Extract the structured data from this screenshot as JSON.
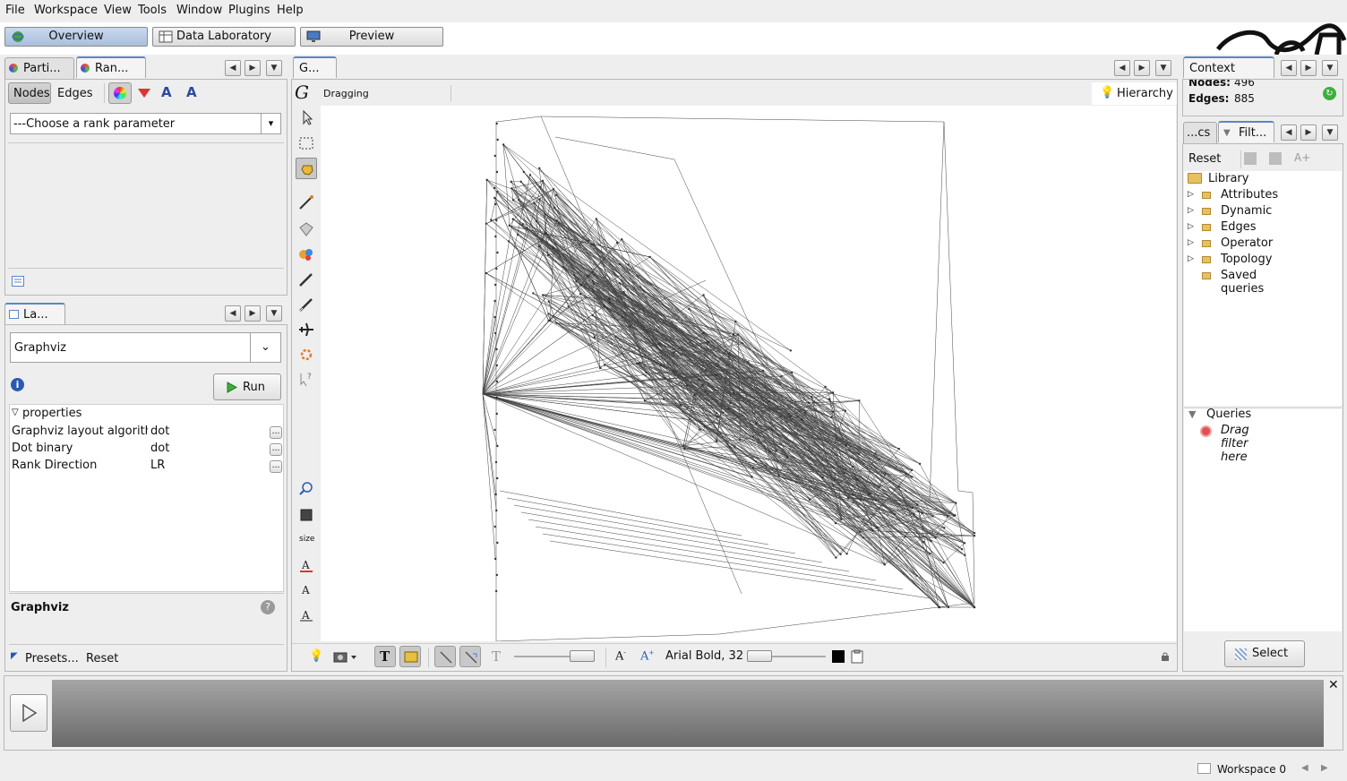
{
  "menu": [
    "File",
    "Workspace",
    "View",
    "Tools",
    "Window",
    "Plugins",
    "Help"
  ],
  "perspectives": [
    {
      "label": "Overview",
      "selected": true
    },
    {
      "label": "Data Laboratory",
      "selected": false
    },
    {
      "label": "Preview",
      "selected": false
    }
  ],
  "left_top": {
    "tabs": [
      "Parti...",
      "Ran..."
    ],
    "subtabs": [
      "Nodes",
      "Edges"
    ],
    "rank_select": "---Choose a rank parameter"
  },
  "layout_panel": {
    "tab": "La...",
    "algorithm": "Graphviz",
    "run_label": "Run",
    "properties_header": "properties",
    "properties": [
      {
        "name": "Graphviz layout algorithm",
        "value": "dot"
      },
      {
        "name": "Dot binary",
        "value": "dot"
      },
      {
        "name": "Rank Direction",
        "value": "LR"
      }
    ],
    "description_title": "Graphviz",
    "presets_label": "Presets...",
    "reset_label": "Reset"
  },
  "graph_panel": {
    "tab": "G...",
    "status": "Dragging",
    "hierarchy_label": "Hierarchy",
    "font_label": "Arial Bold, 32",
    "size_label": "size"
  },
  "context": {
    "tab": "Context",
    "nodes_label": "Nodes:",
    "nodes_value": "496",
    "edges_label": "Edges:",
    "edges_value": "885"
  },
  "filters": {
    "tabs": [
      "...cs",
      "Filt..."
    ],
    "reset_label": "Reset",
    "library_label": "Library",
    "items": [
      "Attributes",
      "Dynamic",
      "Edges",
      "Operator",
      "Topology",
      "Saved queries"
    ],
    "queries_label": "Queries",
    "drag_hint": "Drag filter here",
    "select_label": "Select"
  },
  "statusbar": {
    "workspace_label": "Workspace 0"
  },
  "colors": {
    "accent": "#5a87c5",
    "graph_bg": "#ffffff",
    "edge": "#444444"
  }
}
